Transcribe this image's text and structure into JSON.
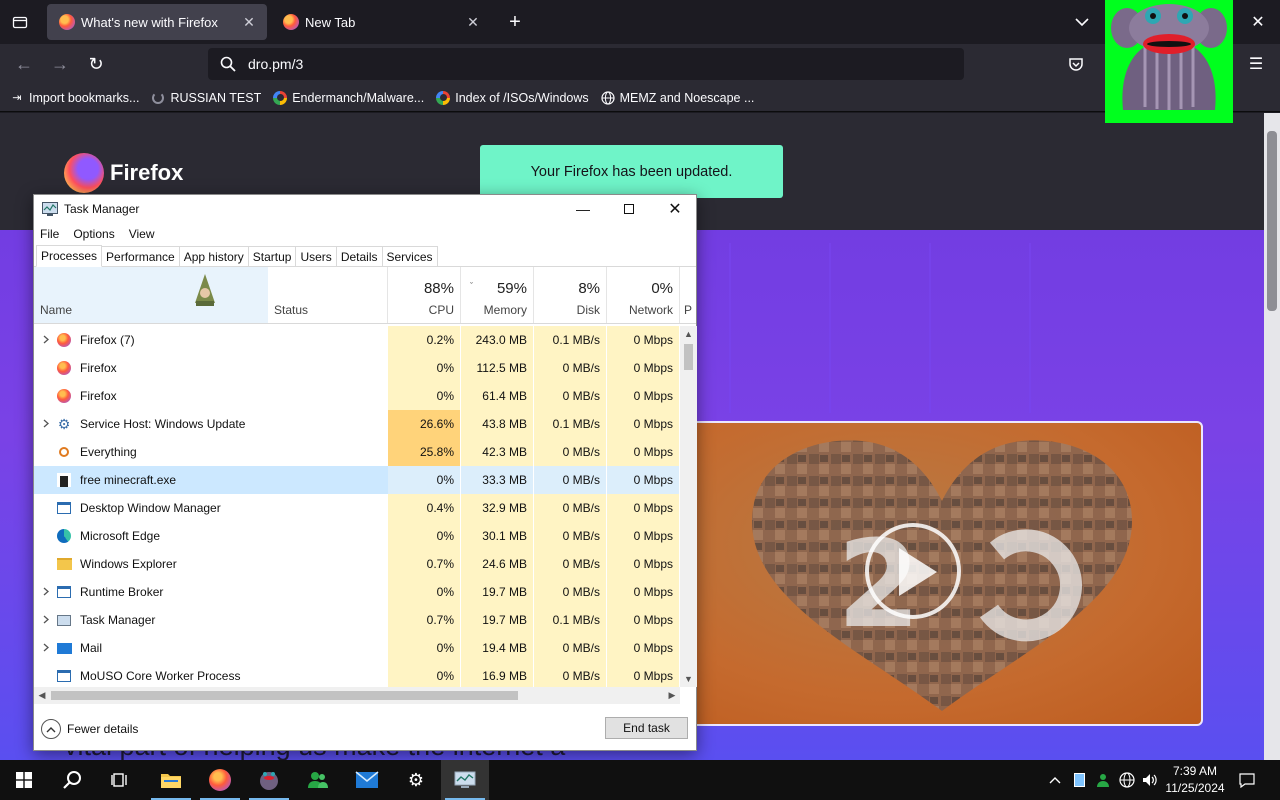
{
  "browser": {
    "tabs": [
      {
        "title": "What's new with Firefox",
        "active": true
      },
      {
        "title": "New Tab",
        "active": false
      }
    ],
    "url": "dro.pm/3",
    "bookmarks": [
      {
        "label": "Import bookmarks...",
        "icon": "import-icon"
      },
      {
        "label": "RUSSIAN TEST",
        "icon": "loading-icon"
      },
      {
        "label": "Endermanch/Malware...",
        "icon": "google-icon"
      },
      {
        "label": "Index of /ISOs/Windows",
        "icon": "google-icon"
      },
      {
        "label": "MEMZ and Noescape ...",
        "icon": "globe-icon"
      }
    ]
  },
  "page": {
    "logo_text": "Firefox",
    "update_banner": "Your Firefox has been updated.",
    "body_text": "vital part of helping us make the internet a"
  },
  "taskmgr": {
    "title": "Task Manager",
    "menu": [
      "File",
      "Options",
      "View"
    ],
    "tabs": [
      "Processes",
      "Performance",
      "App history",
      "Startup",
      "Users",
      "Details",
      "Services"
    ],
    "columns": {
      "name": "Name",
      "status": "Status",
      "cpu": {
        "pct": "88%",
        "label": "CPU"
      },
      "memory": {
        "pct": "59%",
        "label": "Memory"
      },
      "disk": {
        "pct": "8%",
        "label": "Disk"
      },
      "network": {
        "pct": "0%",
        "label": "Network"
      },
      "power": "P"
    },
    "processes": [
      {
        "name": "Firefox (7)",
        "expand": true,
        "icon": "firefox-icon",
        "cpu": "0.2%",
        "mem": "243.0 MB",
        "disk": "0.1 MB/s",
        "net": "0 Mbps"
      },
      {
        "name": "Firefox",
        "expand": false,
        "icon": "firefox-icon",
        "cpu": "0%",
        "mem": "112.5 MB",
        "disk": "0 MB/s",
        "net": "0 Mbps"
      },
      {
        "name": "Firefox",
        "expand": false,
        "icon": "firefox-icon",
        "cpu": "0%",
        "mem": "61.4 MB",
        "disk": "0 MB/s",
        "net": "0 Mbps"
      },
      {
        "name": "Service Host: Windows Update",
        "expand": true,
        "icon": "gear-icon",
        "cpu": "26.6%",
        "mem": "43.8 MB",
        "disk": "0.1 MB/s",
        "net": "0 Mbps"
      },
      {
        "name": "Everything",
        "expand": false,
        "icon": "magnifier-icon",
        "cpu": "25.8%",
        "mem": "42.3 MB",
        "disk": "0 MB/s",
        "net": "0 Mbps"
      },
      {
        "name": "free minecraft.exe",
        "expand": false,
        "icon": "creeper-icon",
        "cpu": "0%",
        "mem": "33.3 MB",
        "disk": "0 MB/s",
        "net": "0 Mbps",
        "selected": true
      },
      {
        "name": "Desktop Window Manager",
        "expand": false,
        "icon": "window-icon",
        "cpu": "0.4%",
        "mem": "32.9 MB",
        "disk": "0 MB/s",
        "net": "0 Mbps"
      },
      {
        "name": "Microsoft Edge",
        "expand": false,
        "icon": "edge-icon",
        "cpu": "0%",
        "mem": "30.1 MB",
        "disk": "0 MB/s",
        "net": "0 Mbps"
      },
      {
        "name": "Windows Explorer",
        "expand": false,
        "icon": "folder-icon",
        "cpu": "0.7%",
        "mem": "24.6 MB",
        "disk": "0 MB/s",
        "net": "0 Mbps"
      },
      {
        "name": "Runtime Broker",
        "expand": true,
        "icon": "window-icon",
        "cpu": "0%",
        "mem": "19.7 MB",
        "disk": "0 MB/s",
        "net": "0 Mbps"
      },
      {
        "name": "Task Manager",
        "expand": true,
        "icon": "taskmgr-icon",
        "cpu": "0.7%",
        "mem": "19.7 MB",
        "disk": "0.1 MB/s",
        "net": "0 Mbps"
      },
      {
        "name": "Mail",
        "expand": true,
        "icon": "mail-icon",
        "cpu": "0%",
        "mem": "19.4 MB",
        "disk": "0 MB/s",
        "net": "0 Mbps"
      },
      {
        "name": "MoUSO Core Worker Process",
        "expand": false,
        "icon": "window-icon",
        "cpu": "0%",
        "mem": "16.9 MB",
        "disk": "0 MB/s",
        "net": "0 Mbps"
      }
    ],
    "fewer_details": "Fewer details",
    "end_task": "End task"
  },
  "taskbar": {
    "time": "7:39 AM",
    "date": "11/25/2024"
  },
  "colors": {
    "cpu_heat_low": "#fff4c4",
    "cpu_heat_high": "#ffd37a",
    "selected_row": "#cce8ff",
    "update_banner": "#6ff4c8",
    "page_purple": "#7a42e6",
    "monkey_bg": "#00ff1e"
  }
}
